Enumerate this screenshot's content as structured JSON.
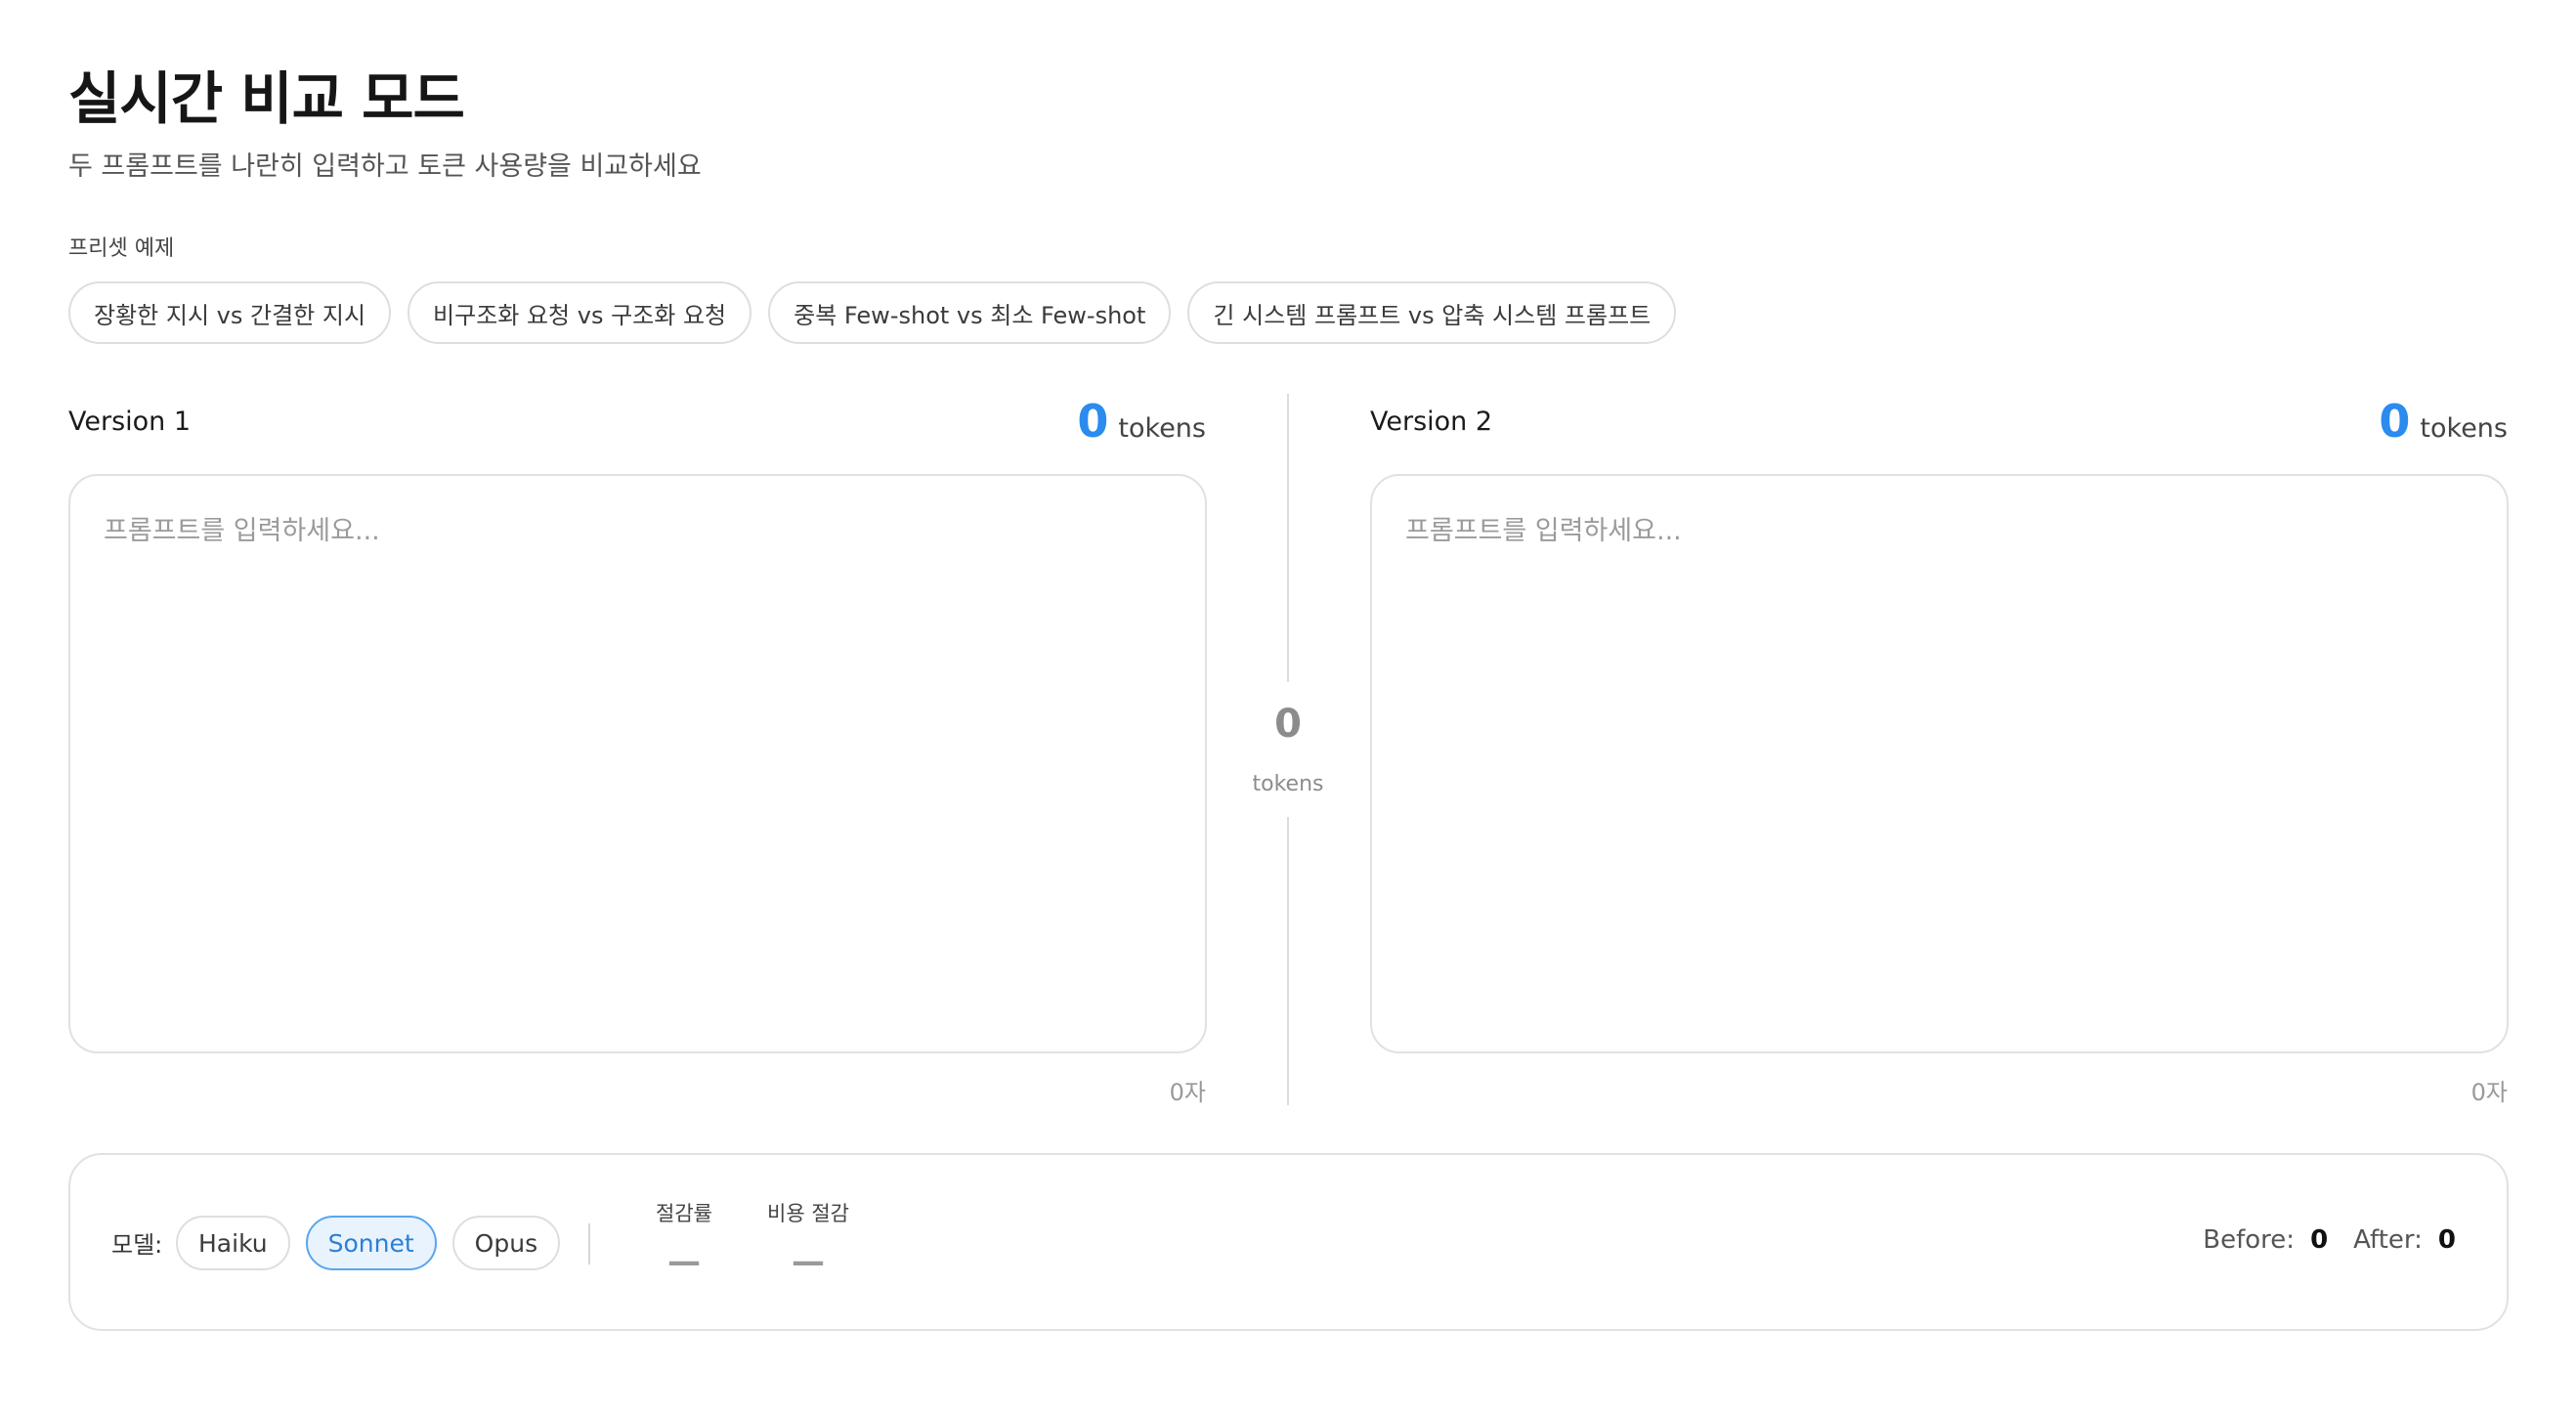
{
  "header": {
    "title": "실시간 비교 모드",
    "subtitle": "두 프롬프트를 나란히 입력하고 토큰 사용량을 비교하세요"
  },
  "presets": {
    "label": "프리셋 예제",
    "items": [
      "장황한 지시 vs 간결한 지시",
      "비구조화 요청 vs 구조화 요청",
      "중복 Few-shot vs 최소 Few-shot",
      "긴 시스템 프롬프트 vs 압축 시스템 프롬프트"
    ]
  },
  "version1": {
    "label": "Version 1",
    "token_count": "0",
    "token_unit": "tokens",
    "placeholder": "프롬프트를 입력하세요...",
    "char_count": "0자"
  },
  "version2": {
    "label": "Version 2",
    "token_count": "0",
    "token_unit": "tokens",
    "placeholder": "프롬프트를 입력하세요...",
    "char_count": "0자"
  },
  "diff": {
    "value": "0",
    "unit": "tokens"
  },
  "bottom": {
    "model_label": "모델:",
    "models": [
      "Haiku",
      "Sonnet",
      "Opus"
    ],
    "selected_model": "Sonnet",
    "savings_rate_label": "절감률",
    "savings_rate_value": "—",
    "cost_savings_label": "비용 절감",
    "cost_savings_value": "—",
    "before_label": "Before:",
    "before_value": "0",
    "after_label": "After:",
    "after_value": "0"
  },
  "colors": {
    "accent": "#2b8bee",
    "active_chip_bg": "#e8f3fd",
    "active_chip_border": "#5aa6ee"
  }
}
